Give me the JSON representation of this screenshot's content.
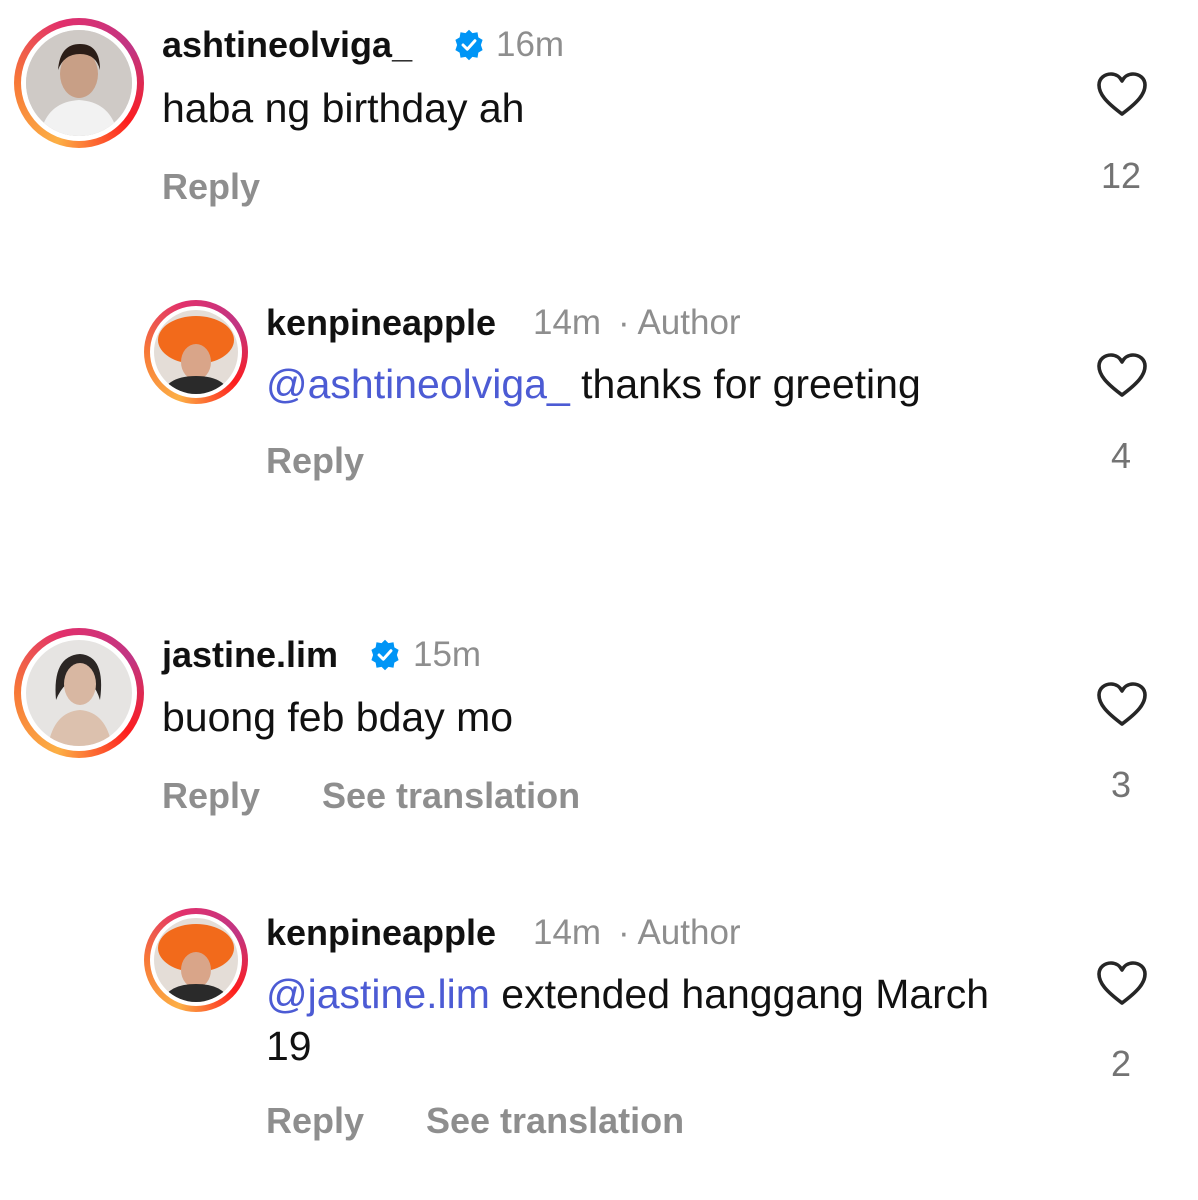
{
  "comments": [
    {
      "username": "ashtineolviga_",
      "time": "16m",
      "text": "haba ng birthday ah",
      "reply_label": "Reply",
      "likes": "12"
    },
    {
      "username": "kenpineapple",
      "time": "14m",
      "author_badge": "· Author",
      "mention": "@ashtineolviga_",
      "text": " thanks for greeting",
      "reply_label": "Reply",
      "likes": "4"
    },
    {
      "username": "jastine.lim",
      "time": "15m",
      "text": "buong feb bday mo",
      "reply_label": "Reply",
      "translate_label": "See translation",
      "likes": "3"
    },
    {
      "username": "kenpineapple",
      "time": "14m",
      "author_badge": "· Author",
      "mention": "@jastine.lim",
      "text": " extended hanggang March 19",
      "reply_label": "Reply",
      "translate_label": "See translation",
      "likes": "2"
    }
  ],
  "colors": {
    "mention": "#4c5bd4",
    "verified": "#0095f6",
    "muted": "#8e8e8e"
  },
  "icons": [
    "heart-icon",
    "verified-badge-icon",
    "avatar"
  ]
}
